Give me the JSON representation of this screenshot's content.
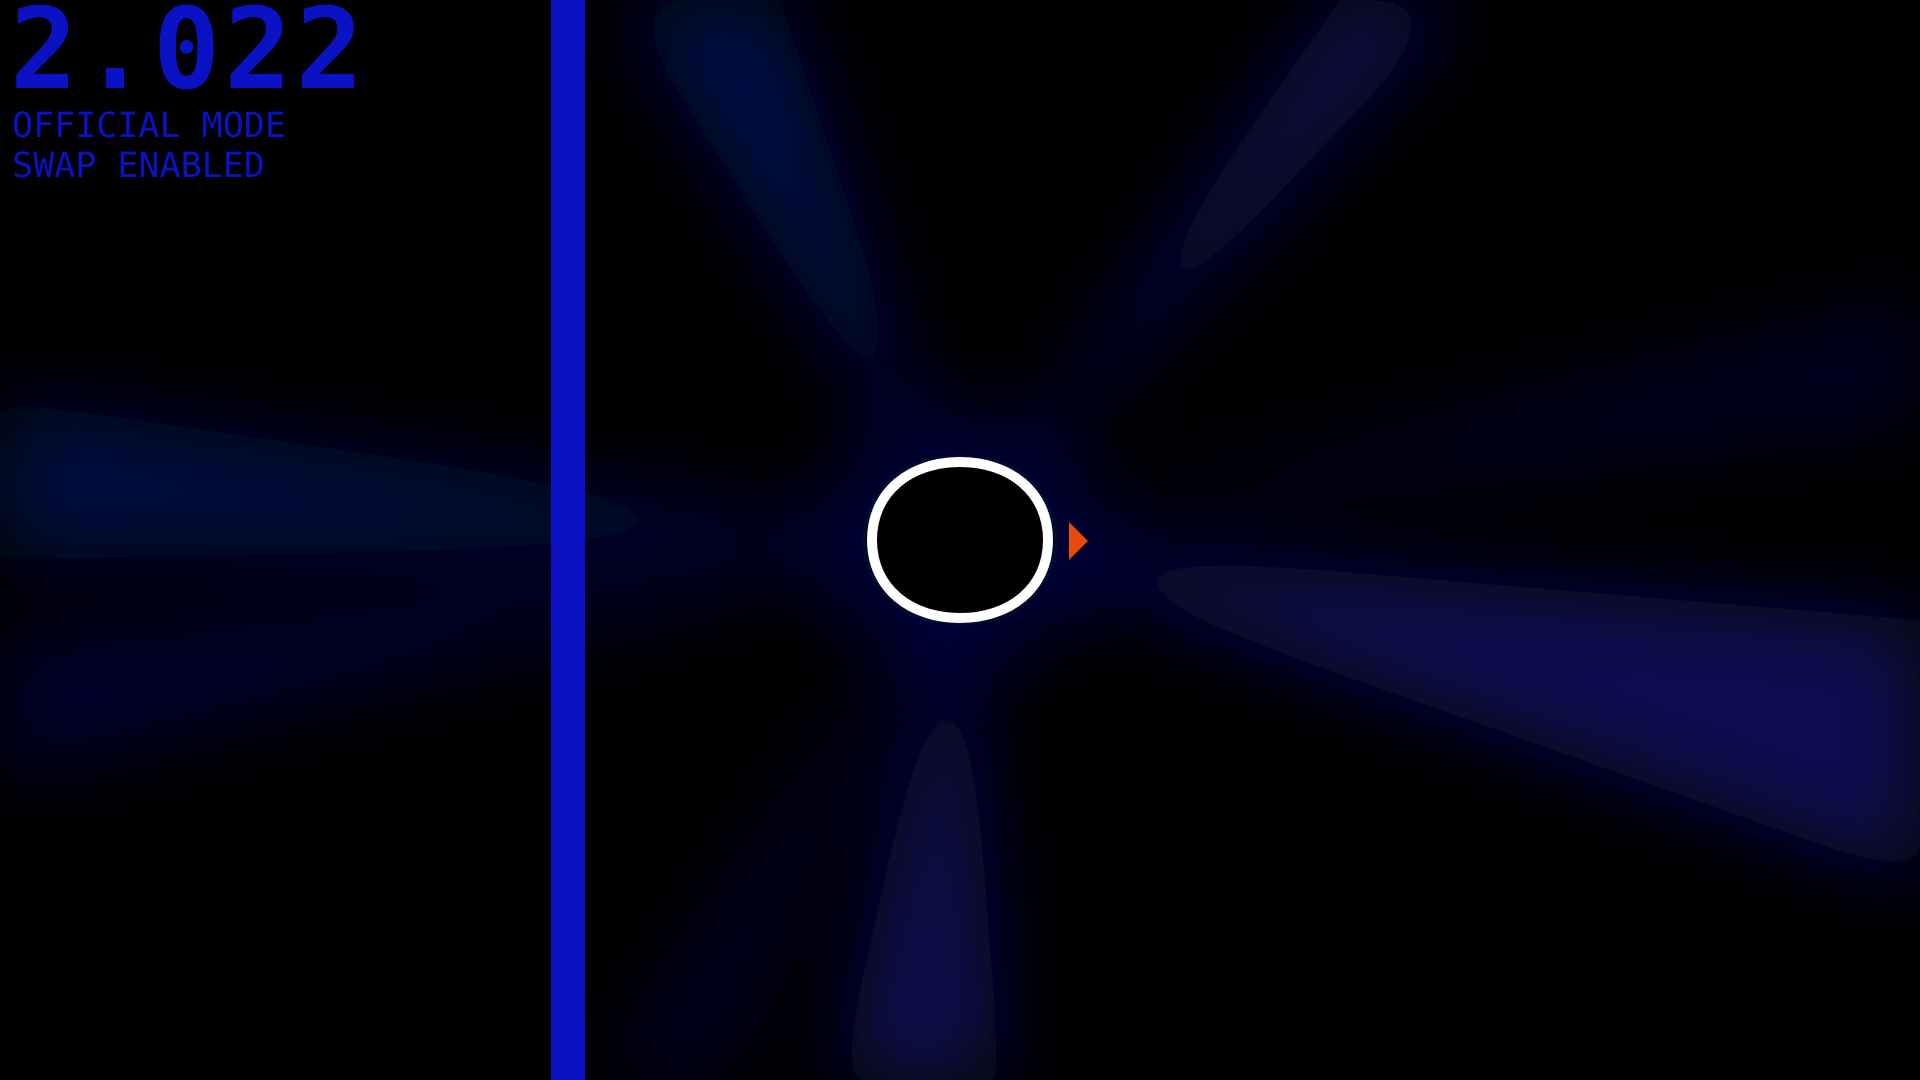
{
  "hud": {
    "timer": "2.022",
    "mode": "OFFICIAL MODE",
    "swap": "SWAP ENABLED"
  },
  "colors": {
    "wall": "#0A12C4",
    "text": "#0A12C4",
    "background": "#000000",
    "glow": "#0B0F5C",
    "center_outline": "#FFFFFF",
    "player": "#E84A0C"
  },
  "icons": {
    "player": "player-triangle-icon",
    "center": "center-hexagon-icon"
  }
}
